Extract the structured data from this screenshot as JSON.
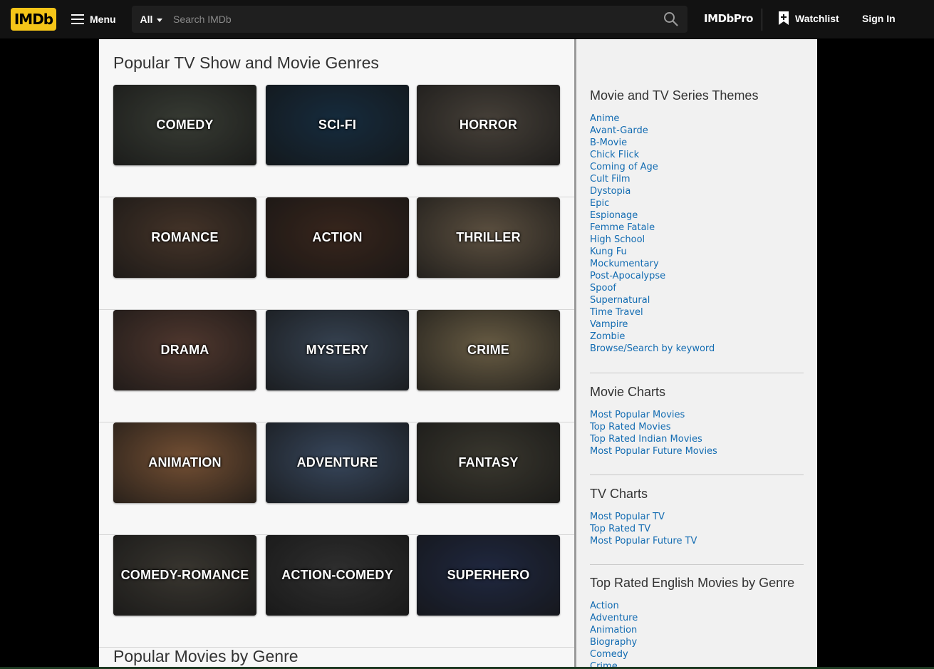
{
  "header": {
    "logo": "IMDb",
    "menu_label": "Menu",
    "search_category": "All",
    "search_placeholder": "Search IMDb",
    "imdbpro_label": "IMDbPro",
    "watchlist_label": "Watchlist",
    "signin_label": "Sign In"
  },
  "main": {
    "title": "Popular TV Show and Movie Genres",
    "bottom_title": "Popular Movies by Genre",
    "genre_rows": [
      [
        {
          "label": "COMEDY",
          "bg": "#4a4f45"
        },
        {
          "label": "SCI-FI",
          "bg": "#1d3a52"
        },
        {
          "label": "HORROR",
          "bg": "#5e564c"
        }
      ],
      [
        {
          "label": "ROMANCE",
          "bg": "#5b4536"
        },
        {
          "label": "ACTION",
          "bg": "#4a3226"
        },
        {
          "label": "THRILLER",
          "bg": "#7a6a55"
        }
      ],
      [
        {
          "label": "DRAMA",
          "bg": "#6a4a3e"
        },
        {
          "label": "MYSTERY",
          "bg": "#48586c"
        },
        {
          "label": "CRIME",
          "bg": "#8a7a5a"
        }
      ],
      [
        {
          "label": "ANIMATION",
          "bg": "#9a6a45"
        },
        {
          "label": "ADVENTURE",
          "bg": "#4a5e7a"
        },
        {
          "label": "FANTASY",
          "bg": "#4d4a3e"
        }
      ],
      [
        {
          "label": "COMEDY-ROMANCE",
          "bg": "#4c4840"
        },
        {
          "label": "ACTION-COMEDY",
          "bg": "#3e3e3e"
        },
        {
          "label": "SUPERHERO",
          "bg": "#2a3555"
        }
      ]
    ]
  },
  "sidebar": {
    "sections": [
      {
        "title": "Movie and TV Series Themes",
        "links": [
          "Anime",
          "Avant-Garde",
          "B-Movie",
          "Chick Flick",
          "Coming of Age",
          "Cult Film",
          "Dystopia",
          "Epic",
          "Espionage",
          "Femme Fatale",
          "High School",
          "Kung Fu",
          "Mockumentary",
          "Post-Apocalypse",
          "Spoof",
          "Supernatural",
          "Time Travel",
          "Vampire",
          "Zombie",
          "Browse/Search by keyword"
        ]
      },
      {
        "title": "Movie Charts",
        "links": [
          "Most Popular Movies",
          "Top Rated Movies",
          "Top Rated Indian Movies",
          "Most Popular Future Movies"
        ]
      },
      {
        "title": "TV Charts",
        "links": [
          "Most Popular TV",
          "Top Rated TV",
          "Most Popular Future TV"
        ]
      },
      {
        "title": "Top Rated English Movies by Genre",
        "links": [
          "Action",
          "Adventure",
          "Animation",
          "Biography",
          "Comedy",
          "Crime"
        ]
      }
    ]
  },
  "colors": {
    "accent": "#f5c518",
    "link": "#136cb2",
    "nav_bg": "#121212"
  }
}
